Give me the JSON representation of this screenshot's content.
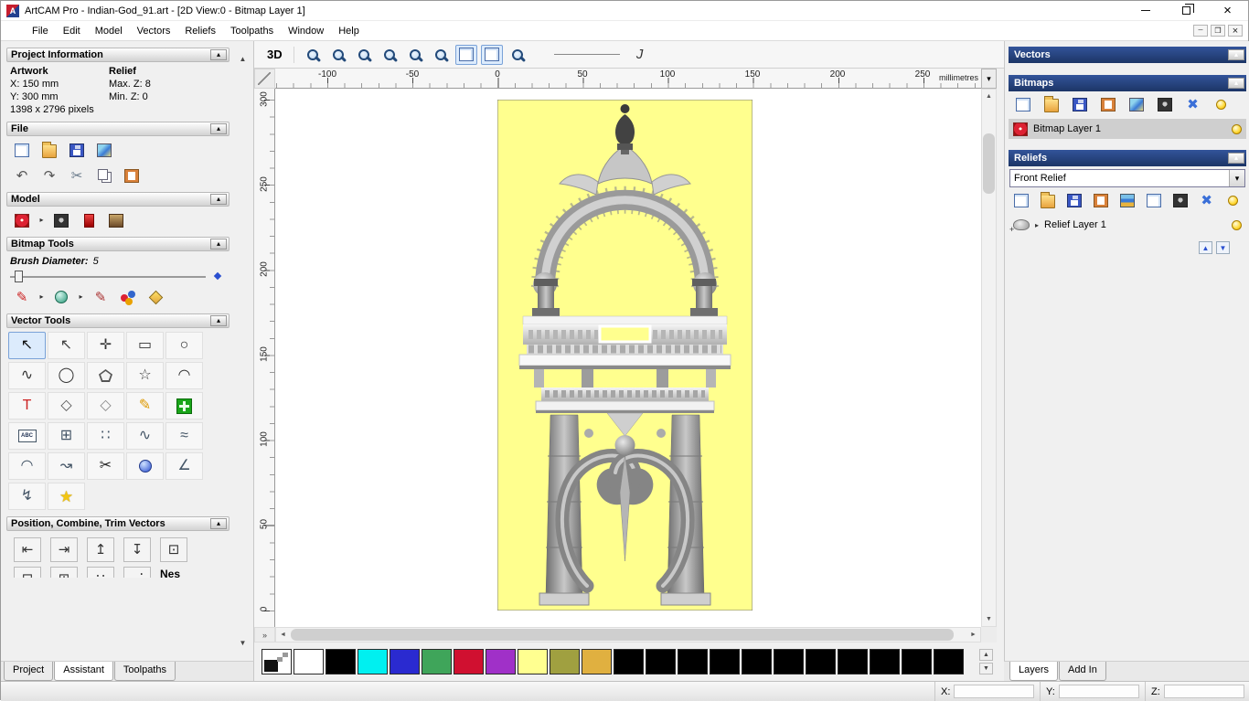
{
  "window": {
    "title": "ArtCAM Pro - Indian-God_91.art - [2D View:0 - Bitmap Layer 1]",
    "menus": [
      "File",
      "Edit",
      "Model",
      "Vectors",
      "Reliefs",
      "Toolpaths",
      "Window",
      "Help"
    ]
  },
  "left_panel": {
    "project_info": {
      "title": "Project Information",
      "artwork_label": "Artwork",
      "relief_label": "Relief",
      "x_value": "X: 150 mm",
      "y_value": "Y: 300 mm",
      "max_z": "Max. Z: 8",
      "min_z": "Min. Z: 0",
      "pixels": "1398 x 2796 pixels"
    },
    "file_section": {
      "title": "File",
      "icons_row1": [
        {
          "n": "new-model-icon",
          "cls": "page"
        },
        {
          "n": "open-model-icon",
          "cls": "folder"
        },
        {
          "n": "save-model-icon",
          "cls": "disk"
        },
        {
          "n": "export-model-icon",
          "cls": "pic"
        }
      ],
      "icons_row2": [
        {
          "n": "undo-icon",
          "g": "↶",
          "c": "#555555"
        },
        {
          "n": "redo-icon",
          "g": "↷",
          "c": "#555555"
        },
        {
          "n": "cut-icon",
          "g": "✂",
          "c": "#667788"
        },
        {
          "n": "copy-icon",
          "cls": "copy"
        },
        {
          "n": "paste-icon",
          "cls": "clipboard"
        }
      ]
    },
    "model_section": {
      "title": "Model",
      "icons": [
        {
          "n": "face-wizard-icon",
          "cls": "pic-red"
        },
        {
          "n": "flyout-arrow-icon",
          "g": "▸",
          "sm": true
        },
        {
          "n": "texture-relief-icon",
          "cls": "pic-dark"
        },
        {
          "n": "sculpting-icon",
          "cls": "statue"
        },
        {
          "n": "face-photo-icon",
          "cls": "portrait"
        }
      ]
    },
    "bitmap_tools": {
      "title": "Bitmap Tools",
      "brush_label": "Brush Diameter:",
      "brush_value": "5",
      "icons": [
        {
          "n": "paint-brush-icon",
          "g": "✎",
          "c": "#cc2222"
        },
        {
          "n": "flyout-arrow-icon",
          "g": "▸",
          "sm": true
        },
        {
          "n": "paint-selective-icon",
          "cls": "sphere"
        },
        {
          "n": "flyout-arrow-icon",
          "g": "▸",
          "sm": true
        },
        {
          "n": "draw-icon",
          "g": "✎",
          "c": "#aa3333"
        },
        {
          "n": "colour-palette-icon",
          "cls": "blobs"
        },
        {
          "n": "flood-fill-icon",
          "cls": "flood"
        }
      ]
    },
    "vector_tools": {
      "title": "Vector Tools",
      "icons": [
        {
          "n": "select-vectors-icon",
          "g": "↖",
          "c": "#111111",
          "p": true
        },
        {
          "n": "node-editing-icon",
          "g": "↖",
          "c": "#444444"
        },
        {
          "n": "transform-vectors-icon",
          "g": "✛",
          "c": "#333333"
        },
        {
          "n": "create-rectangle-icon",
          "g": "▭",
          "c": "#333333"
        },
        {
          "n": "create-circle-icon",
          "g": "○",
          "c": "#333333"
        },
        {
          "n": "create-polyline-icon",
          "g": "∿",
          "c": "#333333"
        },
        {
          "n": "create-ellipse-icon",
          "g": "◯",
          "c": "#333333"
        },
        {
          "n": "create-polygon-icon",
          "cls": "pentagon"
        },
        {
          "n": "create-star-icon",
          "g": "☆",
          "c": "#333333"
        },
        {
          "n": "create-arc-icon",
          "g": "◠",
          "c": "#333333"
        },
        {
          "n": "create-text-icon",
          "g": "T",
          "c": "#cc2222"
        },
        {
          "n": "offset-vectors-icon",
          "g": "◇",
          "c": "#555555"
        },
        {
          "n": "fillet-icon",
          "g": "◇",
          "c": "#888888"
        },
        {
          "n": "vector-doctor-icon",
          "g": "✎",
          "c": "#dd9900"
        },
        {
          "n": "block-paste-icon",
          "cls": "green-cross"
        },
        {
          "n": "paragraph-text-icon",
          "cls": "abc",
          "g": "ABC"
        },
        {
          "n": "bitmap-to-vector-icon",
          "g": "⊞",
          "c": "#445566"
        },
        {
          "n": "nesting-icon",
          "g": "∷",
          "c": "#445566"
        },
        {
          "n": "fit-curve-icon",
          "g": "∿",
          "c": "#445566"
        },
        {
          "n": "smooth-vectors-icon",
          "g": "≈",
          "c": "#445566"
        },
        {
          "n": "join-with-arc-icon",
          "g": "◠",
          "c": "#445566"
        },
        {
          "n": "join-with-line-icon",
          "g": "↝",
          "c": "#445566"
        },
        {
          "n": "trim-vectors-icon",
          "g": "✂",
          "c": "#222222"
        },
        {
          "n": "interactive-trim-icon",
          "cls": "sphere-blue"
        },
        {
          "n": "measure-icon",
          "g": "∠",
          "c": "#445566"
        },
        {
          "n": "section-profile-icon",
          "g": "↯",
          "c": "#445566"
        },
        {
          "n": "wizard-star-icon",
          "cls": "star-yellow",
          "g": "★"
        }
      ]
    },
    "position_section": {
      "title": "Position, Combine, Trim Vectors",
      "icons_row1": [
        {
          "n": "align-left-icon",
          "g": "⇤",
          "c": "#333333"
        },
        {
          "n": "align-right-icon",
          "g": "⇥",
          "c": "#333333"
        },
        {
          "n": "align-top-icon",
          "g": "↥",
          "c": "#333333"
        },
        {
          "n": "align-bottom-icon",
          "g": "↧",
          "c": "#333333"
        },
        {
          "n": "align-centre-icon",
          "g": "⊡",
          "c": "#333333"
        }
      ],
      "icons_row2": [
        {
          "n": "combine-union-icon",
          "g": "⊟",
          "c": "#333333"
        },
        {
          "n": "combine-subtract-icon",
          "g": "⊞",
          "c": "#333333"
        },
        {
          "n": "paste-along-curve-icon",
          "g": "∷",
          "c": "#333333"
        },
        {
          "n": "block-copy-icon",
          "g": "⋰",
          "c": "#333333"
        }
      ],
      "clipped_label": "Nes"
    },
    "tabs": [
      "Project",
      "Assistant",
      "Toolpaths"
    ]
  },
  "canvas": {
    "view3d_label": "3D",
    "toolbar_icons": [
      {
        "n": "zoom-in-icon",
        "cls": "zoom"
      },
      {
        "n": "zoom-out-icon",
        "cls": "zoom"
      },
      {
        "n": "zoom-window-icon",
        "cls": "zoom"
      },
      {
        "n": "zoom-fit-icon",
        "cls": "zoom"
      },
      {
        "n": "zoom-objects-icon",
        "cls": "zoom"
      },
      {
        "n": "zoom-previous-icon",
        "cls": "zoom"
      },
      {
        "n": "snap-toggle-left-icon",
        "cls": "page",
        "p": true
      },
      {
        "n": "snap-toggle-right-icon",
        "cls": "page",
        "p": true
      },
      {
        "n": "zoom-selected-icon",
        "cls": "zoom"
      }
    ],
    "toolbar_icons2": [
      {
        "n": "line-style-icon",
        "g": "J",
        "c": "#333333"
      }
    ],
    "ruler_h": [
      "-100",
      "-50",
      "0",
      "50",
      "100",
      "150",
      "200",
      "250"
    ],
    "ruler_unit": "millimetres",
    "ruler_v": [
      "300",
      "250",
      "200",
      "150",
      "100",
      "50",
      "0"
    ],
    "artwork_bg": "#ffff8e"
  },
  "palette": {
    "colors": [
      "checker",
      "#ffffff",
      "#000000",
      "#00f0f0",
      "#2a2ad0",
      "#3fa55a",
      "#d01030",
      "#a030c8",
      "#ffff90",
      "#a0a040",
      "#e0b040",
      "#000000",
      "#000000",
      "#000000",
      "#000000",
      "#000000",
      "#000000",
      "#000000",
      "#000000",
      "#000000",
      "#000000",
      "#000000"
    ]
  },
  "right_panel": {
    "vectors_title": "Vectors",
    "bitmaps_title": "Bitmaps",
    "bitmaps_icons": [
      {
        "n": "new-bitmap-layer-icon",
        "cls": "page"
      },
      {
        "n": "open-bitmap-icon",
        "cls": "folder"
      },
      {
        "n": "save-bitmap-icon",
        "cls": "disk"
      },
      {
        "n": "merge-bitmap-icon",
        "cls": "clipboard"
      },
      {
        "n": "transparency-icon",
        "cls": "pic"
      },
      {
        "n": "contrast-icon",
        "cls": "pic-dark"
      },
      {
        "n": "delete-bitmap-layer-icon",
        "g": "✖",
        "c": "#3a6fd8"
      },
      {
        "n": "toggle-all-bitmaps-icon",
        "cls": "bulb"
      }
    ],
    "bitmap_layer": "Bitmap Layer 1",
    "reliefs_title": "Reliefs",
    "relief_combo": "Front Relief",
    "reliefs_icons": [
      {
        "n": "new-relief-layer-icon",
        "cls": "page"
      },
      {
        "n": "open-relief-icon",
        "cls": "folder"
      },
      {
        "n": "save-relief-icon",
        "cls": "disk"
      },
      {
        "n": "merge-relief-icon",
        "cls": "clipboard"
      },
      {
        "n": "relief-stack-icon",
        "cls": "stack"
      },
      {
        "n": "duplicate-relief-icon",
        "cls": "page"
      },
      {
        "n": "calculator-icon",
        "cls": "pic-dark"
      },
      {
        "n": "delete-relief-layer-icon",
        "g": "✖",
        "c": "#3a6fd8"
      },
      {
        "n": "toggle-all-reliefs-icon",
        "cls": "bulb"
      }
    ],
    "relief_layer": "Relief Layer 1",
    "tabs": [
      "Layers",
      "Add In"
    ]
  },
  "status_bar": {
    "x_label": "X:",
    "y_label": "Y:",
    "z_label": "Z:"
  }
}
